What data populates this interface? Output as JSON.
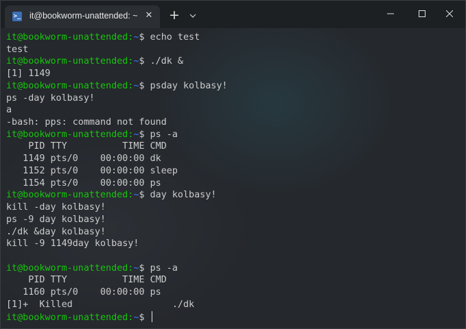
{
  "window": {
    "tab_title": "it@bookworm-unattended: ~",
    "tab_icon": "terminal-icon",
    "tab_icon_glyph": ">_",
    "tab_close": "✕",
    "new_tab": "+",
    "controls": [
      "minimize-icon",
      "maximize-icon",
      "close-icon"
    ]
  },
  "colors": {
    "prompt_user": "#16c60c",
    "prompt_path": "#3b78ff",
    "text": "#cccccc",
    "background": "#25282d",
    "titlebar": "#1d2023"
  },
  "terminal": {
    "prompt_user": "it@bookworm-unattended",
    "prompt_sep": ":",
    "prompt_path": "~",
    "prompt_end": "$ ",
    "lines": [
      {
        "type": "prompt",
        "text": "echo test"
      },
      {
        "type": "output",
        "text": "test"
      },
      {
        "type": "prompt",
        "text": "./dk &"
      },
      {
        "type": "output",
        "text": "[1] 1149"
      },
      {
        "type": "prompt",
        "text": "psday kolbasy!"
      },
      {
        "type": "output",
        "text": "ps -day kolbasy!"
      },
      {
        "type": "output",
        "text": "a"
      },
      {
        "type": "output",
        "text": "-bash: pps: command not found"
      },
      {
        "type": "prompt",
        "text": "ps -a"
      },
      {
        "type": "output",
        "text": "    PID TTY          TIME CMD"
      },
      {
        "type": "output",
        "text": "   1149 pts/0    00:00:00 dk"
      },
      {
        "type": "output",
        "text": "   1152 pts/0    00:00:00 sleep"
      },
      {
        "type": "output",
        "text": "   1154 pts/0    00:00:00 ps"
      },
      {
        "type": "prompt",
        "text": "day kolbasy!"
      },
      {
        "type": "output",
        "text": "kill -day kolbasy!"
      },
      {
        "type": "output",
        "text": "ps -9 day kolbasy!"
      },
      {
        "type": "output",
        "text": "./dk &day kolbasy!"
      },
      {
        "type": "output",
        "text": "kill -9 1149day kolbasy!"
      },
      {
        "type": "output",
        "text": ""
      },
      {
        "type": "prompt",
        "text": "ps -a"
      },
      {
        "type": "output",
        "text": "    PID TTY          TIME CMD"
      },
      {
        "type": "output",
        "text": "   1160 pts/0    00:00:00 ps"
      },
      {
        "type": "output",
        "text": "[1]+  Killed                  ./dk"
      },
      {
        "type": "prompt",
        "text": "",
        "cursor": true
      }
    ]
  }
}
